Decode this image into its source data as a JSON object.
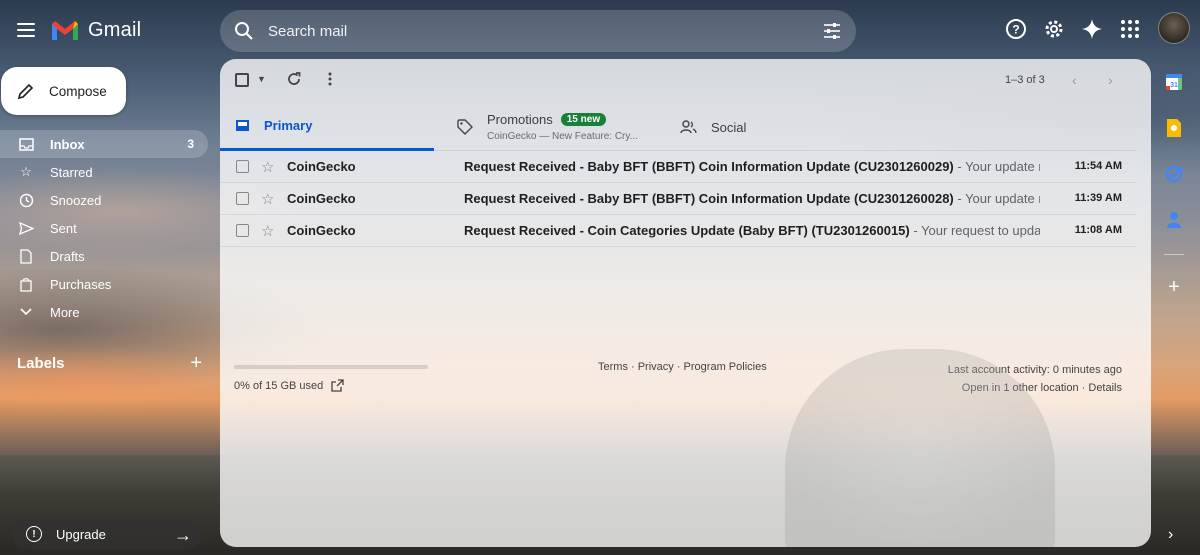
{
  "app": {
    "name": "Gmail"
  },
  "search": {
    "placeholder": "Search mail"
  },
  "compose": {
    "label": "Compose"
  },
  "nav": {
    "items": [
      {
        "label": "Inbox",
        "icon": "inbox-icon",
        "count": "3",
        "active": true
      },
      {
        "label": "Starred",
        "icon": "star-icon"
      },
      {
        "label": "Snoozed",
        "icon": "clock-icon"
      },
      {
        "label": "Sent",
        "icon": "send-icon"
      },
      {
        "label": "Drafts",
        "icon": "draft-icon"
      },
      {
        "label": "Purchases",
        "icon": "tag-icon"
      },
      {
        "label": "More",
        "icon": "chevron-down-icon"
      }
    ]
  },
  "labels": {
    "title": "Labels"
  },
  "upgrade": {
    "label": "Upgrade"
  },
  "toolbar": {
    "pager": "1–3 of 3"
  },
  "tabs": {
    "primary": "Primary",
    "promotions": "Promotions",
    "promotions_badge": "15 new",
    "promotions_snippet": "CoinGecko — New Feature: Cry...",
    "social": "Social"
  },
  "mails": [
    {
      "sender": "CoinGecko",
      "subject": "Request Received - Baby BFT (BBFT) Coin Information Update (CU2301260029)",
      "snippet": " - Your update r...",
      "time": "11:54 AM"
    },
    {
      "sender": "CoinGecko",
      "subject": "Request Received - Baby BFT (BBFT) Coin Information Update (CU2301260028)",
      "snippet": " - Your update r...",
      "time": "11:39 AM"
    },
    {
      "sender": "CoinGecko",
      "subject": "Request Received - Coin Categories Update (Baby BFT) (TU2301260015)",
      "snippet": " - Your request to upda...",
      "time": "11:08 AM"
    }
  ],
  "footer": {
    "storage": "0% of 15 GB used",
    "storage_fraction": 0,
    "links": "Terms · Privacy · Program Policies",
    "activity": "Last account activity: 0 minutes ago",
    "location": "Open in 1 other location · Details"
  },
  "colors": {
    "accent": "#0b57d0",
    "badge": "#188038"
  }
}
